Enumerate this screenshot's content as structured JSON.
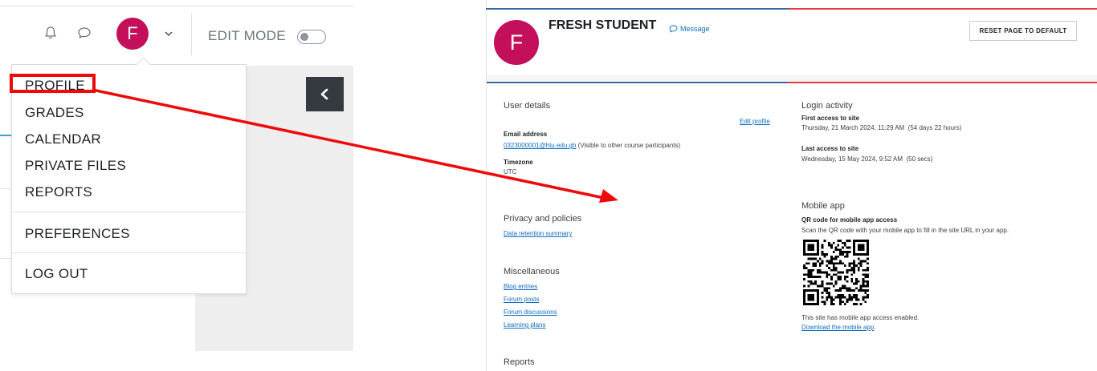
{
  "navbar": {
    "notification_icon": "bell-icon",
    "messages_icon": "chat-bubble-icon",
    "avatar_initial": "F",
    "edit_mode_label": "EDIT MODE",
    "edit_mode_on": false
  },
  "user_menu": {
    "items": [
      "PROFILE",
      "GRADES",
      "CALENDAR",
      "PRIVATE FILES",
      "REPORTS"
    ],
    "preferences": "PREFERENCES",
    "logout": "LOG OUT"
  },
  "profile": {
    "avatar_initial": "F",
    "name": "FRESH STUDENT",
    "message_link": "Message",
    "reset_button": "RESET PAGE TO DEFAULT",
    "user_details": {
      "title": "User details",
      "edit_profile": "Edit profile",
      "email_label": "Email address",
      "email_value": "0323000001@htu.edu.gh",
      "email_note": " (Visible to other course participants)",
      "timezone_label": "Timezone",
      "timezone_value": "UTC"
    },
    "privacy": {
      "title": "Privacy and policies",
      "link": "Data retention summary"
    },
    "miscellaneous": {
      "title": "Miscellaneous",
      "links": [
        "Blog entries",
        "Forum posts",
        "Forum discussions",
        "Learning plans"
      ]
    },
    "reports": {
      "title": "Reports"
    },
    "login_activity": {
      "title": "Login activity",
      "first_label": "First access to site",
      "first_value": "Thursday, 21 March 2024, 11:29 AM  (54 days 22 hours)",
      "last_label": "Last access to site",
      "last_value": "Wednesday, 15 May 2024, 9:52 AM  (50 secs)"
    },
    "mobile_app": {
      "title": "Mobile app",
      "qr_label": "QR code for mobile app access",
      "qr_desc": "Scan the QR code with your mobile app to fill in the site URL in your app.",
      "enabled_text": "This site has mobile app access enabled.",
      "download_link": "Download the mobile app"
    }
  },
  "annotation": {
    "highlight_color": "#ee0a0a"
  }
}
